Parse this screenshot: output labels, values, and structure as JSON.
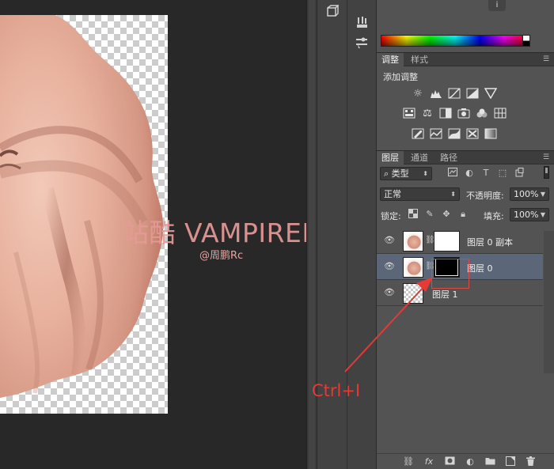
{
  "canvas": {
    "watermark": "站酷 VAMPIREE",
    "credit": "@周鹏Rc",
    "annotation": "Ctrl+I"
  },
  "colors": {
    "arrow": "#e53a35",
    "skin": "#e8b2a0",
    "selected_row": "#5b6778"
  },
  "adjustments": {
    "tabs": [
      "调整",
      "样式"
    ],
    "title": "添加调整",
    "icons": [
      [
        "brightness-icon",
        "levels-icon",
        "curves-icon",
        "exposure-icon",
        "vibrance-icon"
      ],
      [
        "hue-saturation-icon",
        "color-balance-icon",
        "black-white-icon",
        "photo-filter-icon",
        "channel-mixer-icon",
        "color-lookup-icon"
      ],
      [
        "invert-icon",
        "posterize-icon",
        "threshold-icon",
        "selective-color-icon",
        "gradient-map-icon"
      ]
    ]
  },
  "layers_panel": {
    "tabs": [
      "图层",
      "通道",
      "路径"
    ],
    "filter_kind": "类型",
    "blend_mode": "正常",
    "opacity_label": "不透明度:",
    "opacity_value": "100%",
    "lock_label": "锁定:",
    "fill_label": "填充:",
    "fill_value": "100%",
    "layers": [
      {
        "name": "图层 0 副本",
        "mask": "white",
        "selected": false
      },
      {
        "name": "图层 0",
        "mask": "black",
        "selected": true
      },
      {
        "name": "图层 1",
        "mask": "none",
        "selected": false
      }
    ],
    "footer_icons": [
      "link-layers-icon",
      "fx-icon",
      "add-mask-icon",
      "adjustment-layer-icon",
      "new-group-icon",
      "new-layer-icon",
      "delete-layer-icon"
    ]
  }
}
